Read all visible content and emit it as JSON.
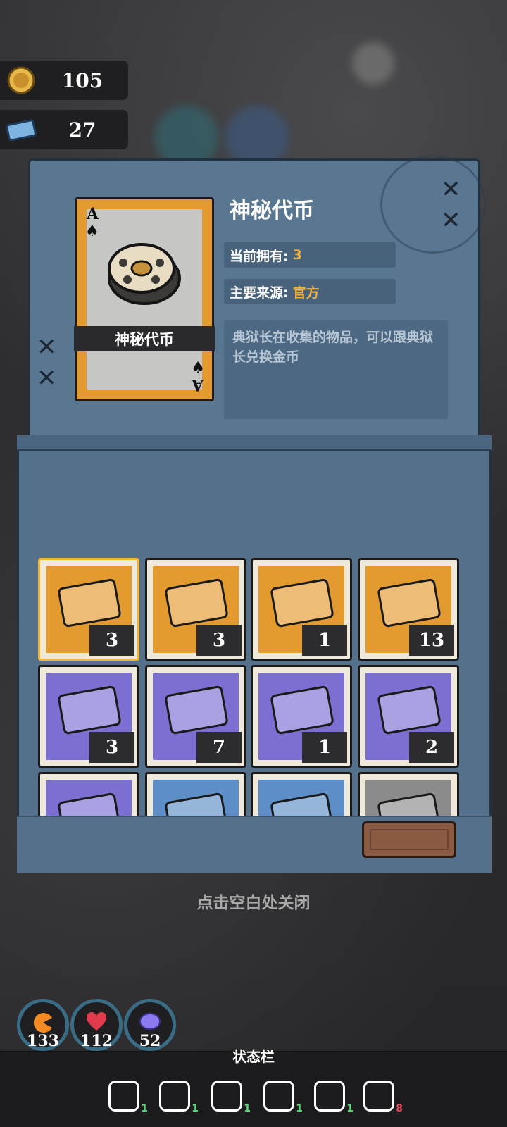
{
  "currency": [
    {
      "name": "coin-icon",
      "value": "105"
    },
    {
      "name": "ticket-icon",
      "value": "27"
    }
  ],
  "detail": {
    "title": "神秘代币",
    "card_label": "神秘代币",
    "card_rank": "A",
    "owned_label": "当前拥有:",
    "owned_value": "3",
    "source_label": "主要来源:",
    "source_value": "官方",
    "description": "典狱长在收集的物品，可以跟典狱长兑换金币"
  },
  "inventory": [
    {
      "item": "film-reel-icon",
      "count": "3",
      "bg": "#e39a2e",
      "selected": true
    },
    {
      "item": "gold-badge-icon",
      "count": "3",
      "bg": "#e39a2e"
    },
    {
      "item": "medical-card-icon",
      "count": "1",
      "bg": "#e39a2e"
    },
    {
      "item": "ribbon-card-icon",
      "count": "13",
      "bg": "#e39a2e"
    },
    {
      "item": "toy-ticket-icon",
      "count": "3",
      "bg": "#7b6fd1"
    },
    {
      "item": "blue-token-icon",
      "count": "7",
      "bg": "#7b6fd1"
    },
    {
      "item": "sunglasses-card-icon",
      "count": "1",
      "bg": "#7b6fd1"
    },
    {
      "item": "first-aid-kit-icon",
      "count": "2",
      "bg": "#7b6fd1"
    },
    {
      "item": "item-icon",
      "count": "",
      "bg": "#7b6fd1"
    },
    {
      "item": "item-icon",
      "count": "",
      "bg": "#5d8ec8"
    },
    {
      "item": "item-icon",
      "count": "",
      "bg": "#5d8ec8"
    },
    {
      "item": "item-icon",
      "count": "",
      "bg": "#8b8b8b"
    }
  ],
  "close_hint": "点击空白处关闭",
  "stats": [
    {
      "name": "hunger-stat",
      "value": "133",
      "color": "#f28b22"
    },
    {
      "name": "health-stat",
      "value": "112",
      "color": "#e23b4d"
    },
    {
      "name": "sanity-stat",
      "value": "52",
      "color": "#8a7cf0"
    }
  ],
  "statusbar": {
    "title": "状态栏",
    "items": [
      {
        "name": "light-icon",
        "count": "1"
      },
      {
        "name": "snowflake-icon",
        "count": "1"
      },
      {
        "name": "tools-icon",
        "count": "1"
      },
      {
        "name": "weather-icon",
        "count": "1"
      },
      {
        "name": "strength-icon",
        "count": "1"
      },
      {
        "name": "masks-icon",
        "count": "8"
      }
    ]
  }
}
